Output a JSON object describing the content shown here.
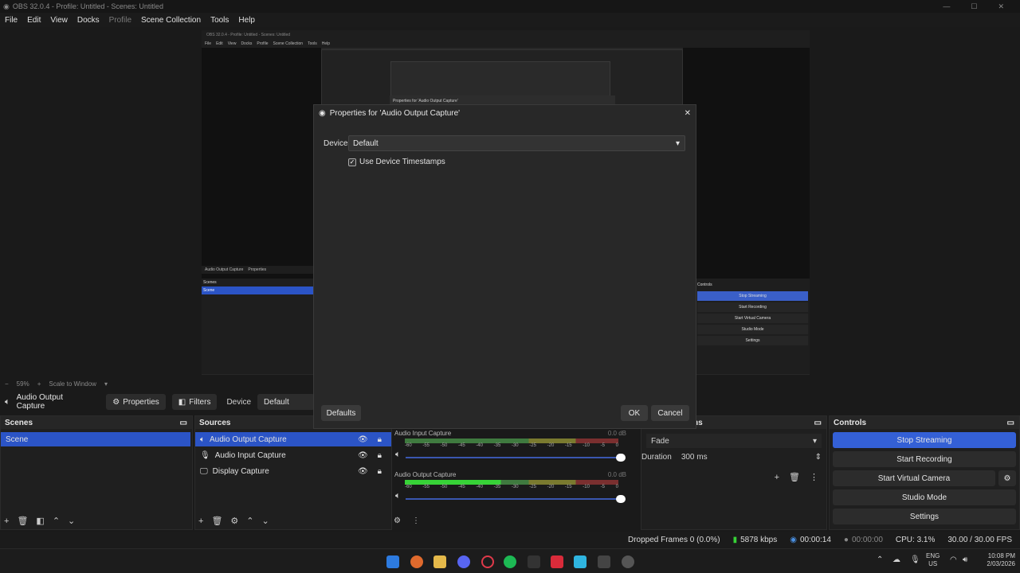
{
  "window": {
    "title": "OBS 32.0.4 - Profile: Untitled - Scenes: Untitled"
  },
  "menu": [
    "File",
    "Edit",
    "View",
    "Docks",
    "Profile",
    "Scene Collection",
    "Tools",
    "Help"
  ],
  "preview": {
    "title": "OBS 32.0.4 - Profile: Untitled - Scenes: Untitled",
    "menu": [
      "File",
      "Edit",
      "View",
      "Docks",
      "Profile",
      "Scene Collection",
      "Tools",
      "Help"
    ],
    "props_title": "Properties for 'Audio Output Capture'",
    "source": "Audio Output Capture",
    "props_btn": "Properties",
    "scenes_label": "Scenes",
    "scene": "Scene",
    "zoom": "Scale to Window",
    "controls_label": "Controls",
    "controls": [
      "Stop Streaming",
      "Start Recording",
      "Start Virtual Camera",
      "Studio Mode",
      "Settings"
    ],
    "status": "00:00:14   00:00:00  CPU: 3.1%  30.00 / 30.00 FPS",
    "clock": "10:08 PM",
    "date": "2/03/2026"
  },
  "zoombar": {
    "zoom": "59%",
    "mode": "Scale to Window"
  },
  "source_toolbar": {
    "source": "Audio Output Capture",
    "properties": "Properties",
    "filters": "Filters",
    "device_label": "Device",
    "device_value": "Default"
  },
  "scenes": {
    "title": "Scenes",
    "items": [
      "Scene"
    ]
  },
  "sources": {
    "title": "Sources",
    "items": [
      "Audio Output Capture",
      "Audio Input Capture",
      "Display Capture"
    ]
  },
  "mixer": {
    "channels": [
      {
        "name": "Audio Input Capture",
        "db": "0.0 dB",
        "level": 0
      },
      {
        "name": "Audio Output Capture",
        "db": "0.0 dB",
        "level": 0.45
      }
    ],
    "scale": [
      "-60",
      "-55",
      "-50",
      "-45",
      "-40",
      "-35",
      "-30",
      "-25",
      "-20",
      "-15",
      "-10",
      "-5",
      "0"
    ]
  },
  "transitions": {
    "title_partial": "ns",
    "type": "Fade",
    "duration_label": "Duration",
    "duration_value": "300 ms"
  },
  "controls": {
    "title": "Controls",
    "buttons": [
      "Stop Streaming",
      "Start Recording",
      "Start Virtual Camera",
      "Studio Mode",
      "Settings"
    ]
  },
  "status": {
    "dropped": "Dropped Frames 0 (0.0%)",
    "bitrate": "5878 kbps",
    "stream_time": "00:00:14",
    "rec_time": "00:00:00",
    "cpu": "CPU: 3.1%",
    "fps": "30.00 / 30.00 FPS"
  },
  "dialog": {
    "title": "Properties for 'Audio Output Capture'",
    "device_label": "Device",
    "device_value": "Default",
    "timestamps_label": "Use Device Timestamps",
    "timestamps_checked": true,
    "defaults": "Defaults",
    "ok": "OK",
    "cancel": "Cancel"
  },
  "taskbar": {
    "lang1": "ENG",
    "lang2": "US",
    "time": "10:08 PM",
    "date": "2/03/2026"
  },
  "colors": {
    "accent": "#3460d6",
    "bg": "#1a1a1a",
    "meter_green": "#37d237"
  }
}
